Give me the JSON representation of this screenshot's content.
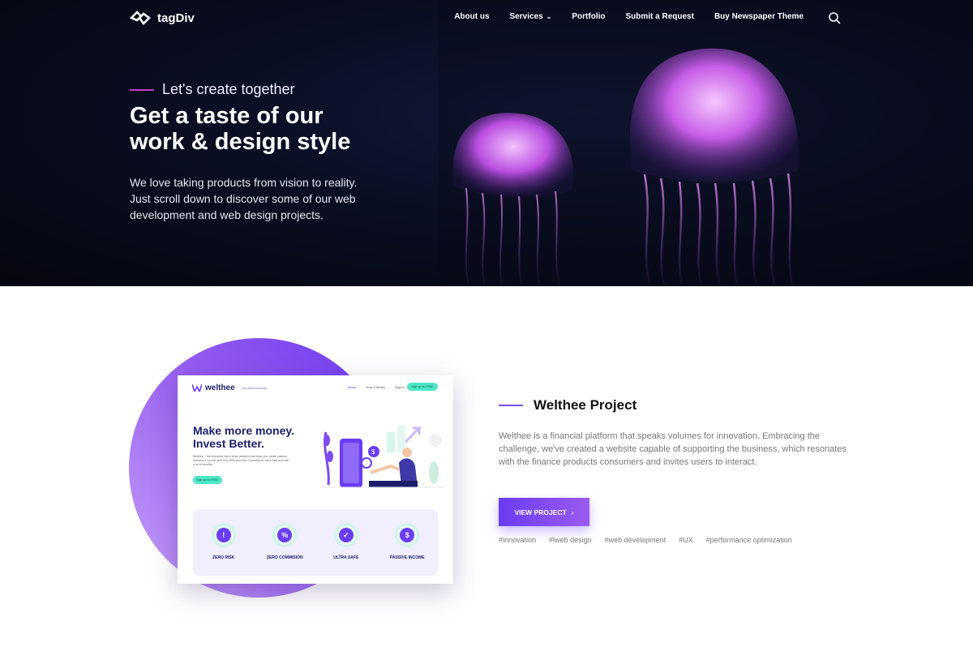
{
  "brand": {
    "name": "tagDiv",
    "icon": "tagdiv-logo-icon"
  },
  "nav": {
    "items": [
      {
        "label": "About us",
        "has_dropdown": false
      },
      {
        "label": "Services",
        "has_dropdown": true
      },
      {
        "label": "Portfolio",
        "has_dropdown": false
      },
      {
        "label": "Submit a Request",
        "has_dropdown": false
      },
      {
        "label": "Buy Newspaper Theme",
        "has_dropdown": false
      }
    ],
    "dropdown_glyph": "⌄",
    "search_icon": "search-icon"
  },
  "hero": {
    "kicker": "Let's create together",
    "title_line1": "Get a taste of our",
    "title_line2": "work & design style",
    "desc_line1": "We love taking products from vision to reality.",
    "desc_line2": "Just scroll down to discover some of our web",
    "desc_line3": "development and web design projects.",
    "image": "jellyfish-photo"
  },
  "project": {
    "title": "Welthee Project",
    "description": "Welthee is a financial platform that speaks volumes for innovation. Embracing the challenge, we've created a website capable of supporting the business, which resonates with the finance products consumers and invites users to interact.",
    "button_label": "VIEW PROJECT",
    "button_arrow": "›",
    "tags": [
      "#innovation",
      "#lweb design",
      "#web development",
      "#UX",
      "#performance optimization"
    ]
  },
  "mockup": {
    "logo": "welthee",
    "tagline": "Your financial buddy",
    "links": [
      "About",
      "How it Works",
      "Sign In"
    ],
    "signup": "Sign up for FREE",
    "headline_line1": "Make more money.",
    "headline_line2": "Invest Better.",
    "paragraph": "Welthee – the disruptive block chain platform that helps you create passive streams of income with Zero Risk and Zero Commission. Ultra Safe and with a lot of benefits.",
    "cta": "Sign up for FREE",
    "features": [
      {
        "label": "ZERO RISK",
        "glyph": "!"
      },
      {
        "label": "ZERO COMMISION",
        "glyph": "%"
      },
      {
        "label": "ULTRA SAFE",
        "glyph": "✓"
      },
      {
        "label": "PASSIVE INCOME",
        "glyph": "$"
      }
    ]
  },
  "colors": {
    "accent": "#6a3cf2",
    "hero_bg": "#0a0e22",
    "kicker_line": "#c23cce",
    "mint": "#4ee6c8"
  }
}
